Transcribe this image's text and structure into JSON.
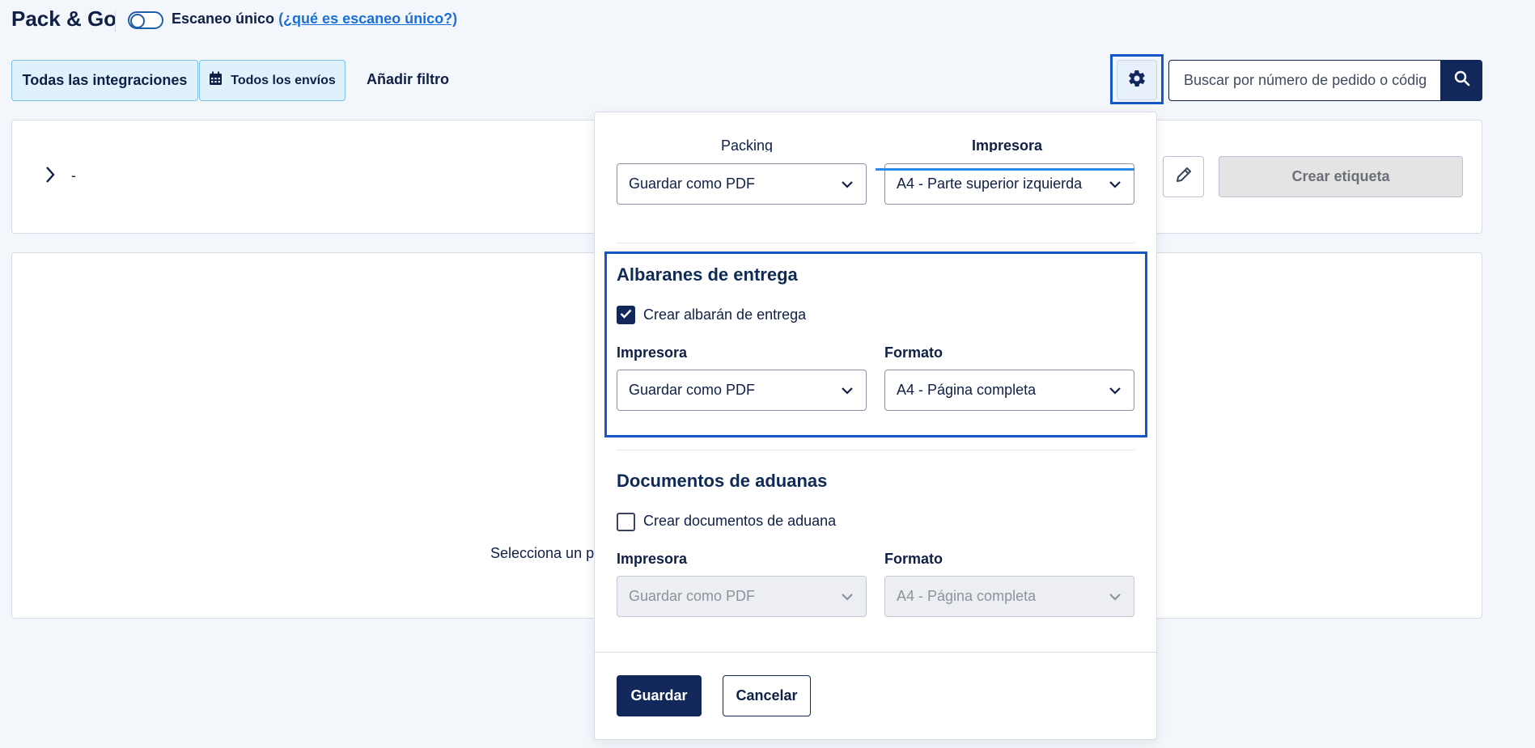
{
  "header": {
    "title": "Pack & Go",
    "single_scan_label": "Escaneo único",
    "single_scan_link": "(¿qué es escaneo único?)"
  },
  "filters": {
    "integrations_label": "Todas las integraciones",
    "shipments_label": "Todos los envíos",
    "add_filter_label": "Añadir filtro"
  },
  "search": {
    "placeholder": "Buscar por número de pedido o código"
  },
  "order_card": {
    "title": "-",
    "create_label_button": "Crear etiqueta"
  },
  "main": {
    "empty_text": "Selecciona un pe"
  },
  "settings_panel": {
    "tabs": [
      "Packing",
      "Impresora"
    ],
    "active_tab": "Impresora",
    "top_row": {
      "printer_value": "Guardar como PDF",
      "format_value": "A4 - Parte superior izquierda"
    },
    "delivery_notes": {
      "title": "Albaranes de entrega",
      "checkbox_label": "Crear albarán de entrega",
      "checked": true,
      "printer_label": "Impresora",
      "printer_value": "Guardar como PDF",
      "format_label": "Formato",
      "format_value": "A4 - Página completa"
    },
    "customs_docs": {
      "title": "Documentos de aduanas",
      "checkbox_label": "Crear documentos de aduana",
      "checked": false,
      "printer_label": "Impresora",
      "printer_value": "Guardar como PDF",
      "format_label": "Formato",
      "format_value": "A4 - Página completa"
    },
    "save_button": "Guardar",
    "cancel_button": "Cancelar"
  },
  "colors": {
    "primary": "#13285a",
    "highlight": "#1556c9",
    "tab_accent": "#2a88e6",
    "filter_bg": "#dff1fb",
    "link": "#1a6fd8"
  }
}
